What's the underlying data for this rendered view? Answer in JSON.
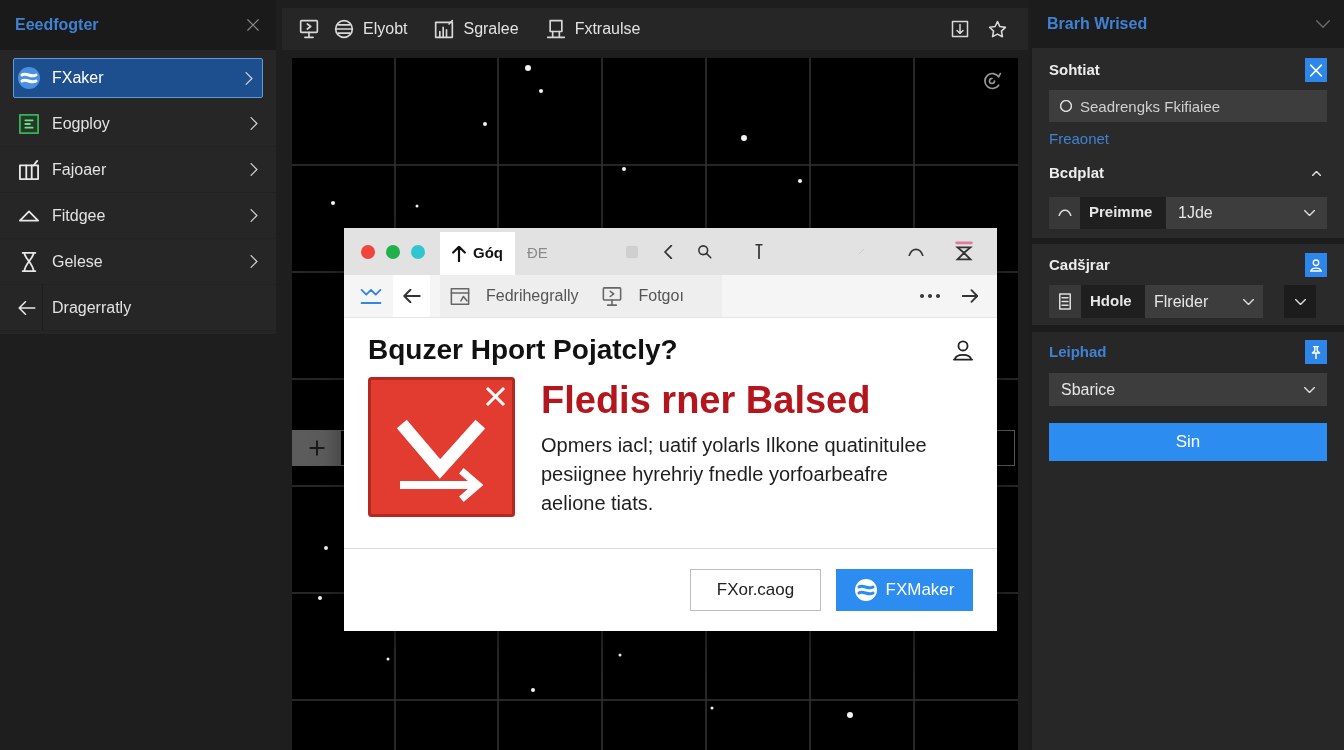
{
  "sidebar": {
    "title": "Eeedfogter",
    "items": [
      {
        "kind": "nav",
        "label": "FXaker",
        "selected": true
      },
      {
        "kind": "nav",
        "label": "Eogploy",
        "selected": false
      },
      {
        "kind": "nav",
        "label": "Fajoaer",
        "selected": false
      },
      {
        "kind": "nav",
        "label": "Fitdgee",
        "selected": false
      },
      {
        "kind": "nav",
        "label": "Gelese",
        "selected": false
      },
      {
        "kind": "back",
        "label": "Dragerratly",
        "selected": false
      }
    ]
  },
  "toolbar": {
    "items": [
      {
        "label": "Elyobt"
      },
      {
        "label": "Sgralee"
      },
      {
        "label": "Fxtraulse"
      }
    ]
  },
  "dialog": {
    "tabs": [
      {
        "label": "Góq",
        "selected": true
      },
      {
        "label": "ĐE",
        "selected": false
      }
    ],
    "bookmarks": [
      {
        "label": "Fedrihegrally"
      },
      {
        "label": "Fotgoı"
      }
    ],
    "title": "Bquzer Hport Pojatcly?",
    "headline": "Fledis rner Balsed",
    "message": "Opmers iacl; uatif yolarls Ilkone quatinitulee pesiignee hyrehriy fnedle yorfoarbeafre aelione tiats.",
    "buttons": [
      {
        "kind": "secondary",
        "label": "FXor.caog"
      },
      {
        "kind": "primary",
        "label": "FXMaker"
      }
    ]
  },
  "right_panel": {
    "title": "Brarh Wrised",
    "sections": [
      {
        "kind": "search",
        "title": "Sohtiat",
        "search": {
          "placeholder": "Seadrengks Fkifiaiee"
        },
        "link": "Freaonet",
        "subtitle": "Bcdplat",
        "field": {
          "label": "Preimme",
          "value": "1Jde"
        }
      },
      {
        "kind": "field",
        "title": "Cadšjrar",
        "field": {
          "label": "Hdole",
          "value": "Flreider"
        }
      },
      {
        "kind": "action",
        "title": "Leiphad",
        "select": {
          "value": "Sbarice"
        },
        "button": "Sin"
      }
    ]
  }
}
